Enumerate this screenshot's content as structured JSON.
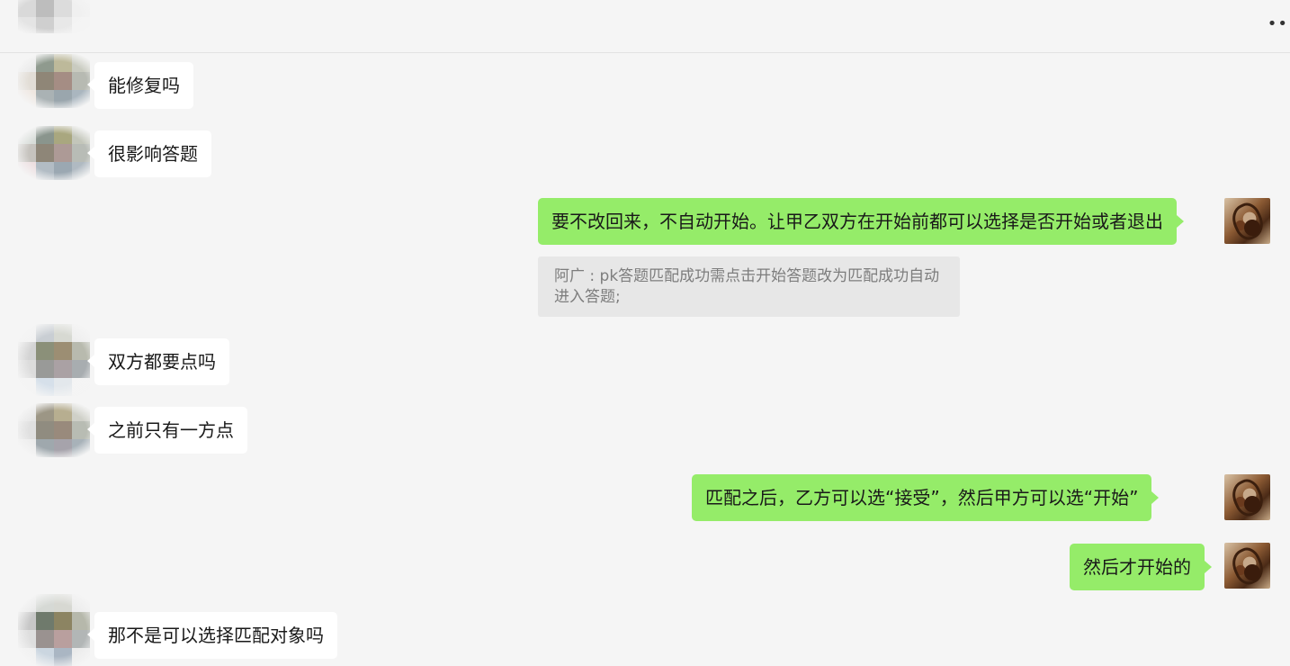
{
  "header": {
    "contact_name": "",
    "more_icon": "more-dots-icon"
  },
  "colors": {
    "background": "#f5f5f5",
    "incoming_bubble": "#ffffff",
    "outgoing_bubble": "#95ec69",
    "quote_bg": "#e7e7e7",
    "quote_text": "#7d7d7d"
  },
  "messages": [
    {
      "side": "in",
      "text": "能修复吗"
    },
    {
      "side": "in",
      "text": "很影响答题"
    },
    {
      "side": "out",
      "text": "要不改回来，不自动开始。让甲乙双方在开始前都可以选择是否开始或者退出"
    },
    {
      "side": "out",
      "quote": "阿广 : pk答题匹配成功需点击开始答题改为匹配成功自动进入答题;"
    },
    {
      "side": "in",
      "text": "双方都要点吗"
    },
    {
      "side": "in",
      "text": "之前只有一方点"
    },
    {
      "side": "out",
      "text": "匹配之后，乙方可以选“接受”，然后甲方可以选“开始”"
    },
    {
      "side": "out",
      "text": "然后才开始的"
    },
    {
      "side": "in",
      "text": "那不是可以选择匹配对象吗"
    }
  ]
}
